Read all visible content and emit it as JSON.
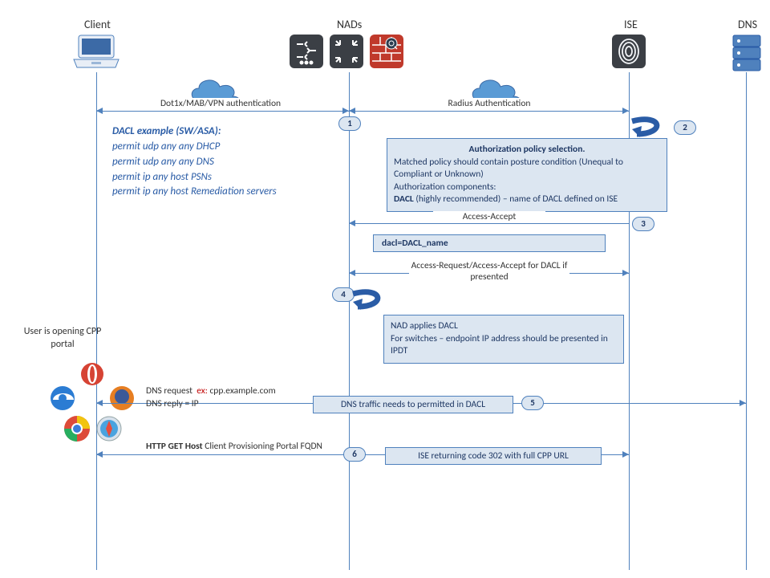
{
  "columns": {
    "client": "Client",
    "nads": "NADs",
    "ise": "ISE",
    "dns": "DNS"
  },
  "msg1": "Dot1x/MAB/VPN  authentication",
  "msg2": "Radius Authentication",
  "dacl_example": {
    "title": "DACL example (SW/ASA):",
    "l1": "permit udp any any  DHCP",
    "l2": "permit udp any any DNS",
    "l3": "permit ip any host PSNs",
    "l4": "permit ip any host Remediation servers"
  },
  "authz_box": {
    "l1": "Authorization  policy selection.",
    "l2": "Matched policy should contain posture condition (Unequal to Compliant or Unknown)",
    "l3": "Authorization components:",
    "l4a": "DACL",
    "l4b": " (highly recommended) – name of DACL defined on ISE"
  },
  "access_accept": "Access-Accept",
  "dacl_name": "dacl=DACL_name",
  "access_req_dacl": "Access-Request/Access-Accept for DACL if presented",
  "nad_applies": {
    "l1": "NAD applies DACL",
    "l2": "For switches – endpoint IP address should be presented in IPDT"
  },
  "side_text": "User is opening CPP portal",
  "dns_req_pre": "DNS request",
  "dns_req_ex": "ex: ",
  "dns_req_host": "cpp.example.com",
  "dns_reply": "DNS reply = IP",
  "dns_permit_box": "DNS traffic needs to permitted in DACL",
  "http_get_pre": "HTTP GET Host ",
  "http_get_rest": "Client Provisioning Portal FQDN",
  "ise_302_box": "ISE returning code 302 with full CPP URL",
  "steps": {
    "s1": "1",
    "s2": "2",
    "s3": "3",
    "s4": "4",
    "s5": "5",
    "s6": "6"
  }
}
